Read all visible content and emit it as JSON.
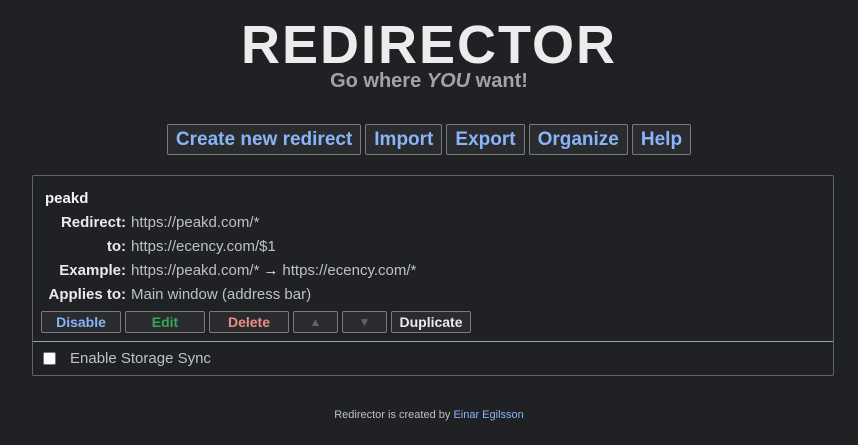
{
  "header": {
    "logo": "REDIRECTOR",
    "tagline_pre": "Go where ",
    "tagline_em": "YOU",
    "tagline_post": " want!"
  },
  "menu": {
    "create": "Create new redirect",
    "import": "Import",
    "export": "Export",
    "organize": "Organize",
    "help": "Help"
  },
  "redirect": {
    "title": "peakd",
    "redirect_label": "Redirect:",
    "redirect_value": "https://peakd.com/*",
    "to_label": "to:",
    "to_value": "https://ecency.com/$1",
    "example_label": "Example:",
    "example_from": "https://peakd.com/*",
    "example_arrow": "→",
    "example_to": "https://ecency.com/*",
    "applies_label": "Applies to:",
    "applies_value": "Main window (address bar)"
  },
  "actions": {
    "disable": "Disable",
    "edit": "Edit",
    "delete": "Delete",
    "up": "▲",
    "down": "▼",
    "duplicate": "Duplicate"
  },
  "sync": {
    "label": "Enable Storage Sync",
    "checked": false
  },
  "footer": {
    "text": "Redirector is created by ",
    "author": "Einar Egilsson"
  },
  "colors": {
    "background": "#202124",
    "accent": "#8ab4f8",
    "edit": "#34a853",
    "delete": "#f28b82"
  }
}
